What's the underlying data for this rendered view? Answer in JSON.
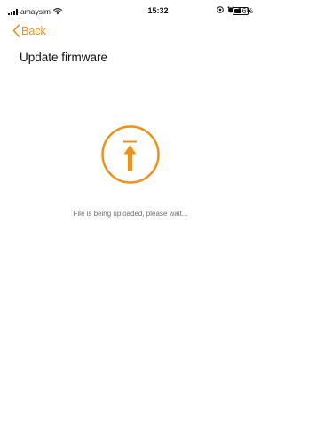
{
  "status_bar": {
    "carrier": "amaysim",
    "time": "15:32",
    "battery": "56%"
  },
  "nav": {
    "back_label": "Back"
  },
  "page": {
    "title": "Update firmware",
    "status_message": "File is being uploaded, please wait..."
  },
  "colors": {
    "accent": "#f0901c",
    "text_secondary": "#6e6e6e"
  },
  "icons": {
    "status": [
      "signal-icon",
      "wifi-icon",
      "location-icon",
      "alarm-icon",
      "battery-icon"
    ],
    "nav": "chevron-left-icon",
    "main": "upload-arrow-icon"
  }
}
